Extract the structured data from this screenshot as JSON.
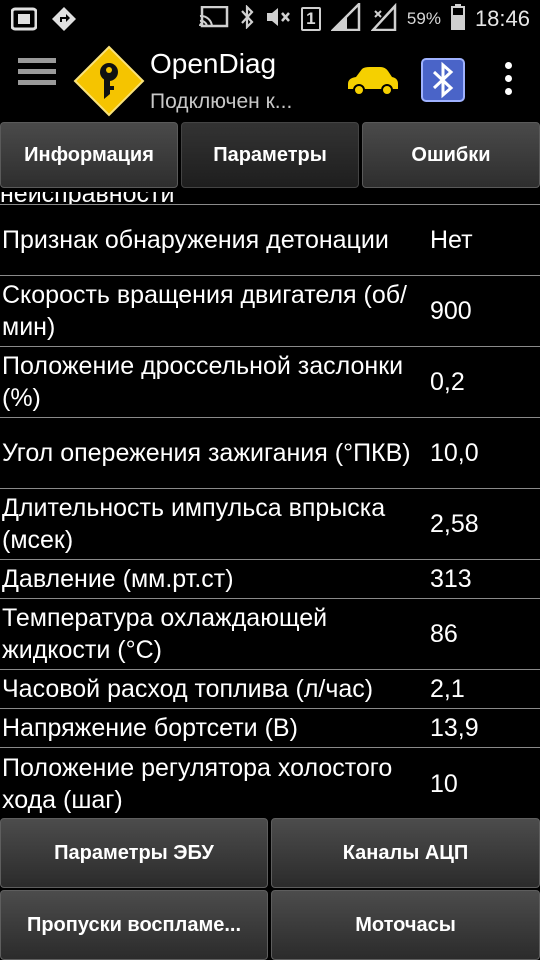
{
  "status_bar": {
    "battery_percent": "59%",
    "time": "18:46",
    "sim_slot": "1",
    "icons": [
      "screenshot-icon",
      "location-warning-icon",
      "cast-icon",
      "bluetooth-icon",
      "mute-icon",
      "signal-icon",
      "battery-icon"
    ]
  },
  "app_bar": {
    "title": "OpenDiag",
    "subtitle": "Подключен к...",
    "colors": {
      "logo": "#f5c400",
      "car": "#f5d000",
      "bluetooth_bg": "#4a64c8"
    }
  },
  "tabs": [
    {
      "label": "Информация",
      "active": false
    },
    {
      "label": "Параметры",
      "active": true
    },
    {
      "label": "Ошибки",
      "active": false
    }
  ],
  "params": {
    "partial_label": "неисправности",
    "rows": [
      {
        "name": "Признак обнаружения детонации",
        "value": "Нет"
      },
      {
        "name": "Скорость вращения двигателя (об/мин)",
        "value": "900"
      },
      {
        "name": "Положение дроссельной заслонки (%)",
        "value": "0,2"
      },
      {
        "name": "Угол опережения зажигания (°ПКВ)",
        "value": "10,0"
      },
      {
        "name": "Длительность импульса впрыска (мсек)",
        "value": "2,58"
      },
      {
        "name": "Давление (мм.рт.ст)",
        "value": "313"
      },
      {
        "name": "Температура охлаждающей жидкости (°С)",
        "value": "86"
      },
      {
        "name": "Часовой расход топлива (л/час)",
        "value": "2,1"
      },
      {
        "name": "Напряжение бортсети (В)",
        "value": "13,9"
      },
      {
        "name": "Положение регулятора холостого хода (шаг)",
        "value": "10"
      }
    ]
  },
  "bottom_buttons": {
    "ecu_params": "Параметры ЭБУ",
    "adc_channels": "Каналы АЦП",
    "misfires": "Пропуски воспламе...",
    "engine_hours": "Моточасы"
  }
}
